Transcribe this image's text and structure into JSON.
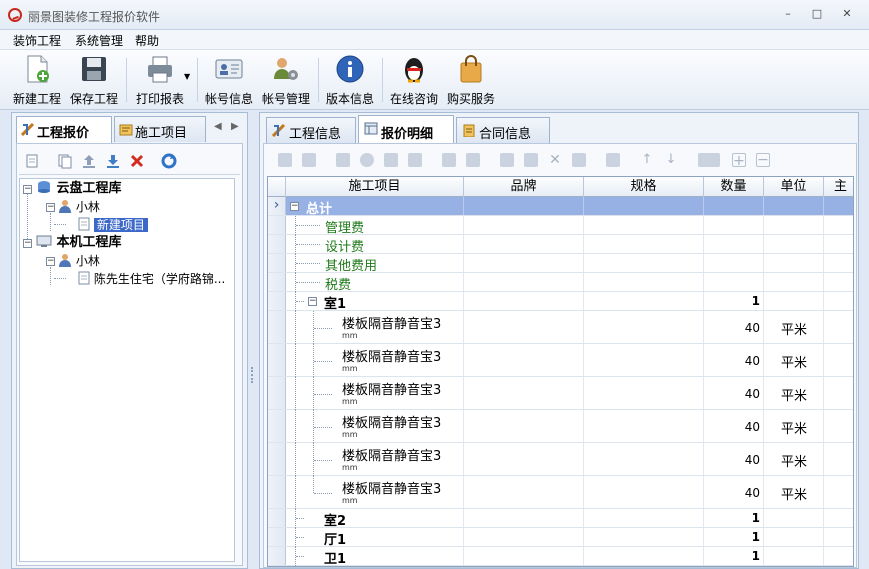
{
  "window": {
    "title": "丽景图装修工程报价软件",
    "controls": [
      "–",
      "□",
      "✕"
    ]
  },
  "menu": [
    "装饰工程",
    "系统管理",
    "帮助"
  ],
  "toolbar": [
    {
      "label": "新建工程",
      "icon": "new-project-icon"
    },
    {
      "label": "保存工程",
      "icon": "save-icon"
    },
    {
      "label": "打印报表",
      "icon": "printer-icon"
    },
    {
      "label": "帐号信息",
      "icon": "account-card-icon"
    },
    {
      "label": "帐号管理",
      "icon": "account-manage-icon"
    },
    {
      "label": "版本信息",
      "icon": "info-icon"
    },
    {
      "label": "在线咨询",
      "icon": "qq-penguin-icon"
    },
    {
      "label": "购买服务",
      "icon": "shopping-bag-icon"
    }
  ],
  "left_panel": {
    "tabs": [
      {
        "label": "工程报价",
        "active": true
      },
      {
        "label": "施工项目",
        "active": false
      }
    ],
    "tree": [
      {
        "label": "云盘工程库",
        "level": 0
      },
      {
        "label": "小林",
        "level": 1
      },
      {
        "label": "新建项目",
        "level": 2,
        "selected": true
      },
      {
        "label": "本机工程库",
        "level": 0
      },
      {
        "label": "小林",
        "level": 1
      },
      {
        "label": "陈先生住宅（学府路锦...",
        "level": 2
      }
    ]
  },
  "right_panel": {
    "tabs": [
      {
        "label": "工程信息",
        "active": false
      },
      {
        "label": "报价明细",
        "active": true
      },
      {
        "label": "合同信息",
        "active": false
      }
    ],
    "grid": {
      "columns": [
        "施工项目",
        "品牌",
        "规格",
        "数量",
        "单位",
        "主"
      ],
      "rows": [
        {
          "name": "总计",
          "style": "total",
          "qty": "",
          "unit": ""
        },
        {
          "name": "管理费",
          "style": "fee",
          "qty": "",
          "unit": ""
        },
        {
          "name": "设计费",
          "style": "fee",
          "qty": "",
          "unit": ""
        },
        {
          "name": "其他费用",
          "style": "fee",
          "qty": "",
          "unit": ""
        },
        {
          "name": "税费",
          "style": "fee",
          "qty": "",
          "unit": ""
        },
        {
          "name": "室1",
          "style": "room",
          "qty": "1",
          "unit": ""
        },
        {
          "name": "楼板隔音静音宝3",
          "sub": "mm",
          "style": "item",
          "qty": "40",
          "unit": "平米"
        },
        {
          "name": "楼板隔音静音宝3",
          "sub": "mm",
          "style": "item",
          "qty": "40",
          "unit": "平米"
        },
        {
          "name": "楼板隔音静音宝3",
          "sub": "mm",
          "style": "item",
          "qty": "40",
          "unit": "平米"
        },
        {
          "name": "楼板隔音静音宝3",
          "sub": "mm",
          "style": "item",
          "qty": "40",
          "unit": "平米"
        },
        {
          "name": "楼板隔音静音宝3",
          "sub": "mm",
          "style": "item",
          "qty": "40",
          "unit": "平米"
        },
        {
          "name": "楼板隔音静音宝3",
          "sub": "mm",
          "style": "item",
          "qty": "40",
          "unit": "平米"
        },
        {
          "name": "室2",
          "style": "room",
          "qty": "1",
          "unit": ""
        },
        {
          "name": "厅1",
          "style": "room",
          "qty": "1",
          "unit": ""
        },
        {
          "name": "卫1",
          "style": "room",
          "qty": "1",
          "unit": ""
        }
      ]
    }
  },
  "colors": {
    "selection": "#3c69c9",
    "total_row": "#98b1e5",
    "fee_text": "#1f7a1a"
  }
}
